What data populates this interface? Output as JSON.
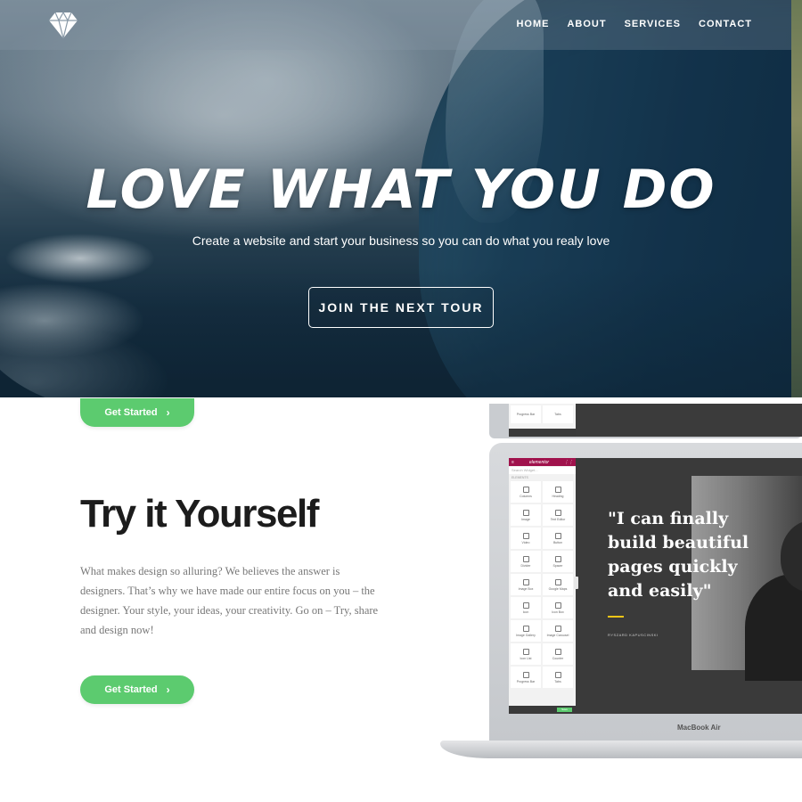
{
  "nav": {
    "logo_icon": "diamond-icon",
    "links": [
      "HOME",
      "ABOUT",
      "SERVICES",
      "CONTACT"
    ]
  },
  "hero": {
    "title": "LOVE WHAT YOU DO",
    "subtitle": "Create a website and start your business so you can do what you realy love",
    "cta_label": "JOIN THE NEXT TOUR"
  },
  "section": {
    "top_button_label": "Get Started",
    "title": "Try it Yourself",
    "text": "What makes design so alluring? We believes the answer is designers. That’s why we have made our entire focus on you – the designer. Your style, your ideas, your creativity. Go on – Try, share and design now!",
    "button_label": "Get Started",
    "chevron": "›"
  },
  "laptop": {
    "brand": "MacBook Air",
    "editor": {
      "logo": "elementor",
      "search_placeholder": "Search Widget...",
      "section_label": "ELEMENTS",
      "widgets": [
        "Columns",
        "Heading",
        "Image",
        "Text Editor",
        "Video",
        "Button",
        "Divider",
        "Spacer",
        "Image Box",
        "Google Maps",
        "Icon",
        "Icon Box",
        "Image Gallery",
        "Image Carousel",
        "Icon List",
        "Counter",
        "Progress Bar",
        "Tabs"
      ],
      "publish_label": "Save",
      "quote": "\"I can finally build beautiful pages quickly and easily\"",
      "author": "RYSZARD KAPUSCINSKI"
    },
    "top_fragment": {
      "widgets": [
        "Progress Bar",
        "Tabs"
      ]
    }
  },
  "colors": {
    "accent_green": "#5ccb6f",
    "title_dark": "#1c1c1c",
    "body_gray": "#777777",
    "editor_header": "#a0124c",
    "quote_accent": "#f2c516"
  }
}
